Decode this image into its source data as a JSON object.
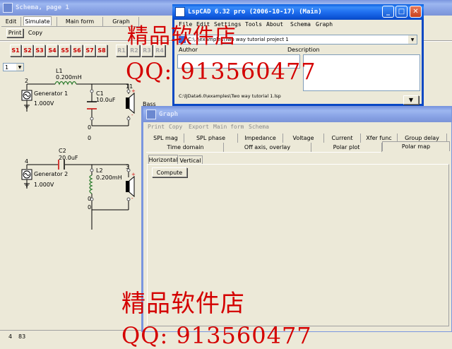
{
  "schema_window": {
    "title": "Schema, page 1",
    "tabs": [
      "Edit",
      "Simulate",
      "Main form",
      "Graph"
    ],
    "buttons": [
      "Print",
      "Copy"
    ],
    "sim_buttons": [
      "S1",
      "S2",
      "S3",
      "S4",
      "S5",
      "S6",
      "S7",
      "S8",
      "R1",
      "R2",
      "R3",
      "R4"
    ],
    "page_select": "1",
    "statusbar": [
      "4",
      "83"
    ]
  },
  "schematic": {
    "l1": {
      "name": "L1",
      "value": "0.200mH"
    },
    "c1": {
      "name": "C1",
      "value": "10.0uF"
    },
    "gen1": {
      "name": "Generator 1",
      "value": "1.000V"
    },
    "c2": {
      "name": "C2",
      "value": "20.0uF"
    },
    "l2": {
      "name": "L2",
      "value": "0.200mH"
    },
    "gen2": {
      "name": "Generator 2",
      "value": "1.000V"
    },
    "nodes": [
      "2",
      "0",
      "0",
      "4",
      "0",
      "0",
      "11",
      "3"
    ],
    "speaker1_label": "Bass"
  },
  "main_window": {
    "title": "LspCAD 6.32 pro (2006-10-17) (Main)",
    "menu": [
      "File",
      "Edit",
      "Settings",
      "Tools",
      "About",
      "Schema",
      "Graph"
    ],
    "project_select": "C:\\..\\examples\\Two way tutorial project 1",
    "columns": [
      "Author",
      "Description"
    ],
    "path": "C:\\lJData6.0\\examples\\Two way tutorial 1.lsp"
  },
  "graph_window": {
    "title": "Graph",
    "menu": [
      "Print",
      "Copy",
      "Export",
      "Main form",
      "Schema"
    ],
    "tabs_row1": [
      "SPL mag",
      "SPL phase",
      "Impedance",
      "Voltage",
      "Current",
      "Xfer func",
      "Group delay"
    ],
    "tabs_row2": [
      "Time domain",
      "Off axis, overlay",
      "Polar plot",
      "Polar map"
    ],
    "subtabs": [
      "Horizontal",
      "Vertical"
    ],
    "compute_label": "Compute"
  },
  "watermark": {
    "line1": "精品软件店",
    "line2": "QQ: 913560477"
  },
  "colors": {
    "accent_red": "#cc0000",
    "title_blue": "#0a5fe0",
    "xp_beige": "#ece9d8"
  }
}
